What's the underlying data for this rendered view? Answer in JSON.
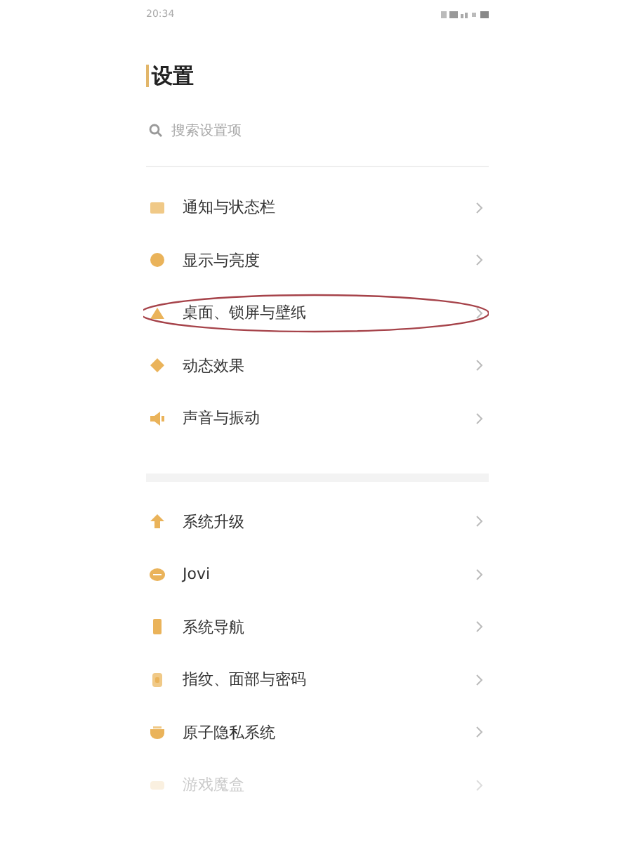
{
  "status_bar": {
    "time": "20:34"
  },
  "title": "设置",
  "search": {
    "placeholder": "搜索设置项"
  },
  "groups": [
    {
      "items": [
        {
          "label": "通知与状态栏",
          "circled": false,
          "faded": false
        },
        {
          "label": "显示与亮度",
          "circled": false,
          "faded": false
        },
        {
          "label": "桌面、锁屏与壁纸",
          "circled": true,
          "faded": false
        },
        {
          "label": "动态效果",
          "circled": false,
          "faded": false
        },
        {
          "label": "声音与振动",
          "circled": false,
          "faded": false
        }
      ]
    },
    {
      "items": [
        {
          "label": "系统升级",
          "circled": false,
          "faded": false
        },
        {
          "label": "Jovi",
          "circled": false,
          "faded": false
        },
        {
          "label": "系统导航",
          "circled": false,
          "faded": false
        },
        {
          "label": "指纹、面部与密码",
          "circled": false,
          "faded": false
        },
        {
          "label": "原子隐私系统",
          "circled": false,
          "faded": false
        },
        {
          "label": "游戏魔盒",
          "circled": false,
          "faded": true
        }
      ]
    }
  ]
}
